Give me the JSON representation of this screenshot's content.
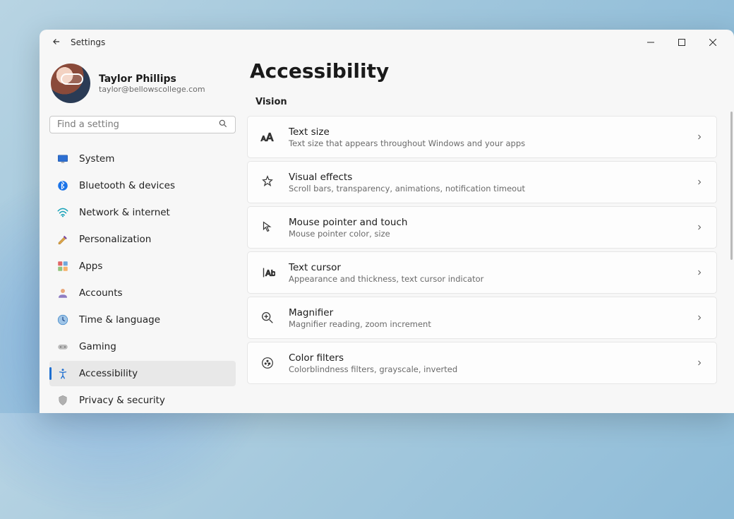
{
  "titlebar": {
    "app_title": "Settings"
  },
  "profile": {
    "name": "Taylor Phillips",
    "email": "taylor@bellowscollege.com"
  },
  "search": {
    "placeholder": "Find a setting"
  },
  "sidebar": {
    "items": [
      {
        "icon": "system",
        "label": "System"
      },
      {
        "icon": "bluetooth",
        "label": "Bluetooth & devices"
      },
      {
        "icon": "network",
        "label": "Network & internet"
      },
      {
        "icon": "personalization",
        "label": "Personalization"
      },
      {
        "icon": "apps",
        "label": "Apps"
      },
      {
        "icon": "accounts",
        "label": "Accounts"
      },
      {
        "icon": "time",
        "label": "Time & language"
      },
      {
        "icon": "gaming",
        "label": "Gaming"
      },
      {
        "icon": "accessibility",
        "label": "Accessibility",
        "active": true
      },
      {
        "icon": "privacy",
        "label": "Privacy & security"
      }
    ]
  },
  "main": {
    "title": "Accessibility",
    "section": "Vision",
    "cards": [
      {
        "icon": "textsize",
        "title": "Text size",
        "sub": "Text size that appears throughout Windows and your apps"
      },
      {
        "icon": "effects",
        "title": "Visual effects",
        "sub": "Scroll bars, transparency, animations, notification timeout"
      },
      {
        "icon": "mouse",
        "title": "Mouse pointer and touch",
        "sub": "Mouse pointer color, size"
      },
      {
        "icon": "cursor",
        "title": "Text cursor",
        "sub": "Appearance and thickness, text cursor indicator"
      },
      {
        "icon": "magnifier",
        "title": "Magnifier",
        "sub": "Magnifier reading, zoom increment"
      },
      {
        "icon": "colorfilters",
        "title": "Color filters",
        "sub": "Colorblindness filters, grayscale, inverted"
      }
    ]
  }
}
